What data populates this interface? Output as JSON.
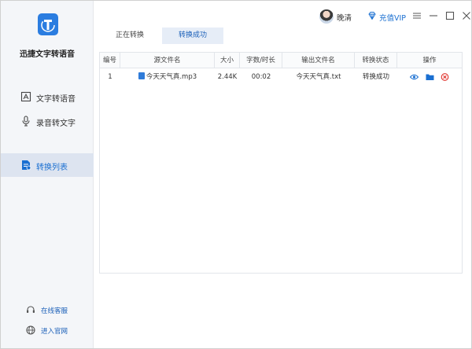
{
  "app": {
    "name": "迅捷文字转语音"
  },
  "sidebar": {
    "items": [
      {
        "label": "文字转语音",
        "icon": "text-doc-icon"
      },
      {
        "label": "录音转文字",
        "icon": "microphone-icon"
      },
      {
        "label": "转换列表",
        "icon": "convert-list-icon",
        "active": true
      }
    ],
    "footer": [
      {
        "label": "在线客服",
        "icon": "headset-icon"
      },
      {
        "label": "进入官网",
        "icon": "globe-icon"
      }
    ]
  },
  "titlebar": {
    "user_name": "晚清",
    "vip_label": "充值VIP",
    "buttons": [
      "vip-diamond-icon",
      "menu-icon",
      "minimize-icon",
      "maximize-icon",
      "close-icon"
    ]
  },
  "tabs": [
    {
      "label": "正在转换",
      "active": false
    },
    {
      "label": "转换成功",
      "active": true
    }
  ],
  "table": {
    "headers": [
      "编号",
      "源文件名",
      "大小",
      "字数/时长",
      "输出文件名",
      "转换状态",
      "操作"
    ],
    "rows": [
      {
        "index": "1",
        "source": "今天天气真.mp3",
        "size": "2.44K",
        "duration": "00:02",
        "output": "今天天气真.txt",
        "status": "转换成功",
        "actions": [
          "eye-icon",
          "folder-icon",
          "delete-icon"
        ]
      }
    ]
  },
  "colors": {
    "accent": "#1a6fd1",
    "delete": "#e0302a",
    "sidebar_bg": "#f4f6f9",
    "active_bg": "#dde4f0"
  }
}
